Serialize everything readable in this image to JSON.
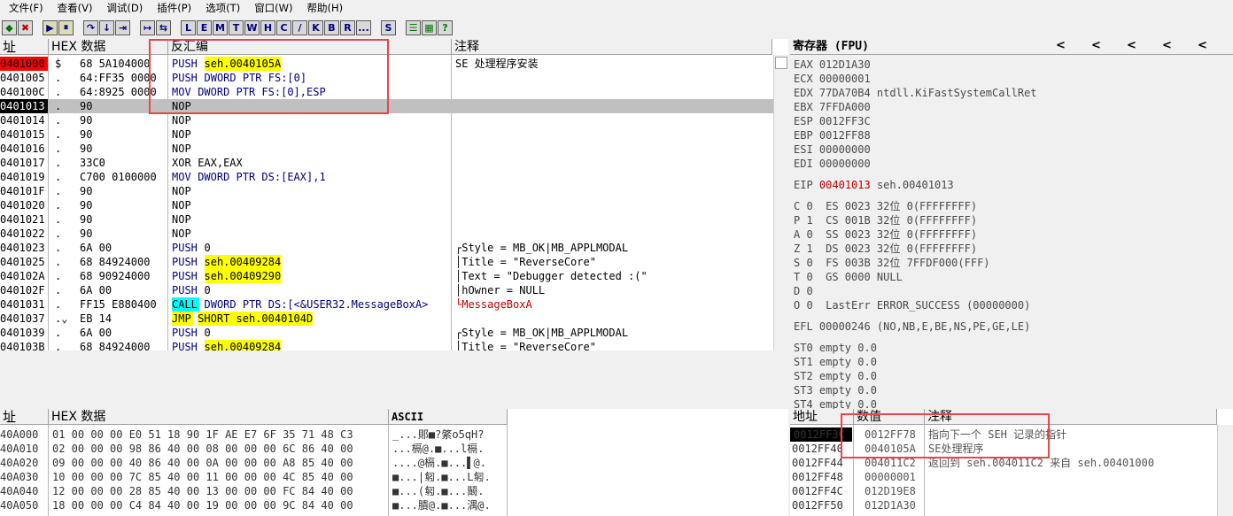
{
  "menu": [
    "文件(F)",
    "查看(V)",
    "调试(D)",
    "插件(P)",
    "选项(T)",
    "窗口(W)",
    "帮助(H)"
  ],
  "toolbar": {
    "buttons": [
      "◆",
      "✖",
      "▶",
      "⏸",
      "↷",
      "↓",
      "⇥",
      "↦",
      "⇆",
      "L",
      "E",
      "M",
      "T",
      "W",
      "H",
      "C",
      "/",
      "K",
      "B",
      "R",
      "...",
      "S",
      "☰",
      "▦",
      "?"
    ]
  },
  "disasm": {
    "headers": {
      "addr": "址",
      "hex": "HEX 数据",
      "disasm": "反汇编",
      "comment": "注释"
    },
    "rows": [
      {
        "addr": "0401000",
        "mark": "$",
        "hex": "68 5A104000",
        "op": "PUSH",
        "arg": "seh.0040105A",
        "cmt": "SE 处理程序安装"
      },
      {
        "addr": "0401005",
        "mark": ".",
        "hex": "64:FF35 0000",
        "op": "PUSH",
        "arg": "DWORD PTR FS:[0]",
        "cmt": ""
      },
      {
        "addr": "040100C",
        "mark": ".",
        "hex": "64:8925 0000",
        "op": "MOV",
        "arg": "DWORD PTR FS:[0],ESP",
        "cmt": ""
      },
      {
        "addr": "0401013",
        "mark": ".",
        "hex": "90",
        "op": "NOP",
        "arg": "",
        "cmt": ""
      },
      {
        "addr": "0401014",
        "mark": ".",
        "hex": "90",
        "op": "NOP",
        "arg": "",
        "cmt": ""
      },
      {
        "addr": "0401015",
        "mark": ".",
        "hex": "90",
        "op": "NOP",
        "arg": "",
        "cmt": ""
      },
      {
        "addr": "0401016",
        "mark": ".",
        "hex": "90",
        "op": "NOP",
        "arg": "",
        "cmt": ""
      },
      {
        "addr": "0401017",
        "mark": ".",
        "hex": "33C0",
        "op": "XOR",
        "arg": "EAX,EAX",
        "cmt": ""
      },
      {
        "addr": "0401019",
        "mark": ".",
        "hex": "C700 0100000",
        "op": "MOV",
        "arg": "DWORD PTR DS:[EAX],1",
        "cmt": ""
      },
      {
        "addr": "040101F",
        "mark": ".",
        "hex": "90",
        "op": "NOP",
        "arg": "",
        "cmt": ""
      },
      {
        "addr": "0401020",
        "mark": ".",
        "hex": "90",
        "op": "NOP",
        "arg": "",
        "cmt": ""
      },
      {
        "addr": "0401021",
        "mark": ".",
        "hex": "90",
        "op": "NOP",
        "arg": "",
        "cmt": ""
      },
      {
        "addr": "0401022",
        "mark": ".",
        "hex": "90",
        "op": "NOP",
        "arg": "",
        "cmt": ""
      },
      {
        "addr": "0401023",
        "mark": ".",
        "hex": "6A 00",
        "op": "PUSH",
        "arg": "0",
        "cmt": "┌Style = MB_OK|MB_APPLMODAL"
      },
      {
        "addr": "0401025",
        "mark": ".",
        "hex": "68 84924000",
        "op": "PUSH",
        "arg": "seh.00409284",
        "cmt": "│Title = \"ReverseCore\""
      },
      {
        "addr": "040102A",
        "mark": ".",
        "hex": "68 90924000",
        "op": "PUSH",
        "arg": "seh.00409290",
        "cmt": "│Text = \"Debugger detected :(\""
      },
      {
        "addr": "040102F",
        "mark": ".",
        "hex": "6A 00",
        "op": "PUSH",
        "arg": "0",
        "cmt": "│hOwner = NULL"
      },
      {
        "addr": "0401031",
        "mark": ".",
        "hex": "FF15 E880400",
        "op": "CALL",
        "arg": "DWORD PTR DS:[<&USER32.MessageBoxA>",
        "cmt": "└MessageBoxA"
      },
      {
        "addr": "0401037",
        "mark": ".⌄",
        "hex": "EB 14",
        "op": "JMP",
        "arg": "SHORT seh.0040104D",
        "cmt": ""
      },
      {
        "addr": "0401039",
        "mark": ".",
        "hex": "6A 00",
        "op": "PUSH",
        "arg": "0",
        "cmt": "┌Style = MB_OK|MB_APPLMODAL"
      },
      {
        "addr": "040103B",
        "mark": ".",
        "hex": "68 84924000",
        "op": "PUSH",
        "arg": "seh.00409284",
        "cmt": "│Title = \"ReverseCore\""
      }
    ]
  },
  "registers": {
    "title": "寄存器 (FPU)",
    "arrows": [
      "<",
      "<",
      "<",
      "<",
      "<",
      "<"
    ],
    "gp": [
      "EAX 012D1A30",
      "ECX 00000001",
      "EDX 77DA70B4 ntdll.KiFastSystemCallRet",
      "EBX 7FFDA000",
      "ESP 0012FF3C",
      "EBP 0012FF88",
      "ESI 00000000",
      "EDI 00000000"
    ],
    "eip_label": "EIP",
    "eip_value": "00401013",
    "eip_sym": "seh.00401013",
    "flags": [
      "C 0  ES 0023 32位 0(FFFFFFFF)",
      "P 1  CS 001B 32位 0(FFFFFFFF)",
      "A 0  SS 0023 32位 0(FFFFFFFF)",
      "Z 1  DS 0023 32位 0(FFFFFFFF)",
      "S 0  FS 003B 32位 7FFDF000(FFF)",
      "T 0  GS 0000 NULL",
      "D 0",
      "O 0  LastErr ERROR_SUCCESS (00000000)"
    ],
    "efl": "EFL 00000246 (NO,NB,E,BE,NS,PE,GE,LE)",
    "fpu": [
      "ST0 empty 0.0",
      "ST1 empty 0.0",
      "ST2 empty 0.0",
      "ST3 empty 0.0",
      "ST4 empty 0.0"
    ]
  },
  "dump": {
    "headers": {
      "addr": "址",
      "hex": "HEX 数据",
      "ascii": "ASCII"
    },
    "rows": [
      {
        "addr": "40A000",
        "hex": "01 00 00 00 E0 51 18 90 1F AE E7 6F 35 71 48 C3",
        "ascii": "_...郥■?綮o5qH?"
      },
      {
        "addr": "40A010",
        "hex": "02 00 00 00 98 86 40 00 08 00 00 00 6C 86 40 00",
        "ascii": "...槅@.■...l槅."
      },
      {
        "addr": "40A020",
        "hex": "09 00 00 00 40 86 40 00 0A 00 00 00 A8 85 40 00",
        "ascii": "....@槅.■...▌@."
      },
      {
        "addr": "40A030",
        "hex": "10 00 00 00 7C 85 40 00 11 00 00 00 4C 85 40 00",
        "ascii": "■...|匑.■...L匑."
      },
      {
        "addr": "40A040",
        "hex": "12 00 00 00 28 85 40 00 13 00 00 00 FC 84 40 00",
        "ascii": "■...(匑.■...鬫."
      },
      {
        "addr": "40A050",
        "hex": "18 00 00 00 C4 84 40 00 19 00 00 00 9C 84 40 00",
        "ascii": "■...膭@.■...湡@."
      }
    ]
  },
  "stack": {
    "headers": {
      "addr": "地址",
      "val": "数值",
      "cmt": "注释"
    },
    "rows": [
      {
        "addr": "0012FF3C",
        "val": "0012FF78",
        "cmt": "指向下一个 SEH 记录的指针"
      },
      {
        "addr": "0012FF40",
        "val": "0040105A",
        "cmt": "SE处理程序"
      },
      {
        "addr": "0012FF44",
        "val": "004011C2",
        "cmt": "返回到 seh.004011C2 来自 seh.00401000"
      },
      {
        "addr": "0012FF48",
        "val": "00000001",
        "cmt": ""
      },
      {
        "addr": "0012FF4C",
        "val": "012D19E8",
        "cmt": ""
      },
      {
        "addr": "0012FF50",
        "val": "012D1A30",
        "cmt": ""
      }
    ]
  }
}
